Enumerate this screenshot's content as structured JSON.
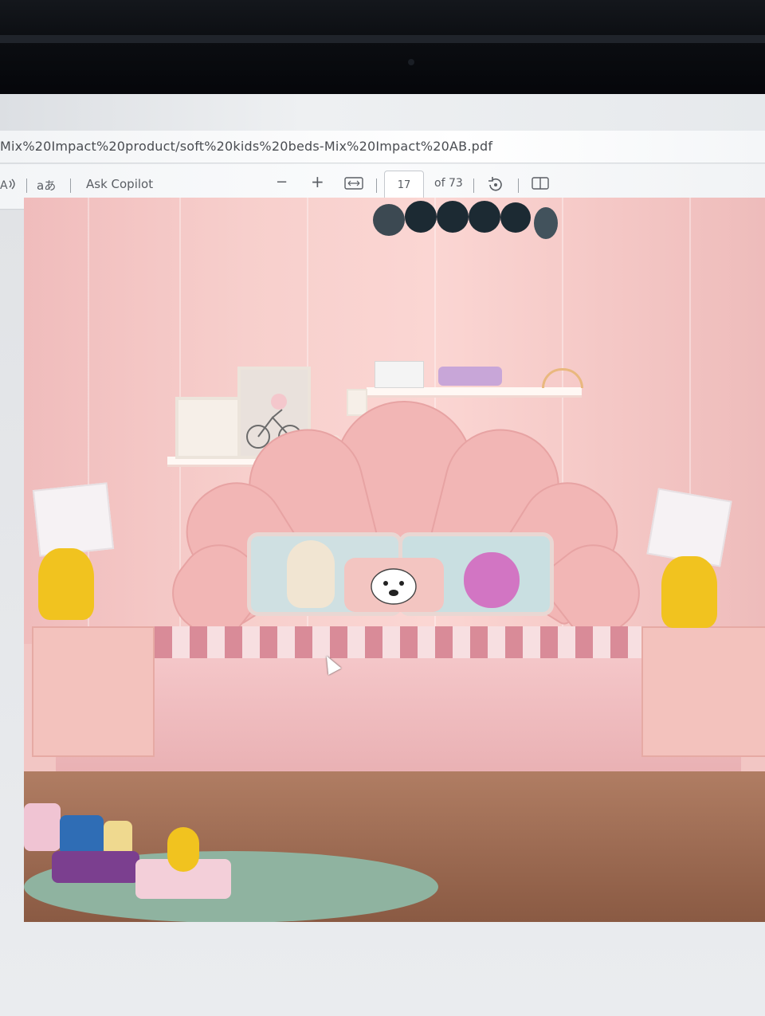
{
  "browser": {
    "url_text": "Mix%20Impact%20product/soft%20kids%20beds-Mix%20Impact%20AB.pdf"
  },
  "pdf_toolbar": {
    "read_aloud_icon": "read-aloud-icon",
    "translate_label": "aあ",
    "ask_copilot_label": "Ask Copilot",
    "zoom_out_label": "−",
    "zoom_in_label": "+",
    "fit_icon": "fit-page-icon",
    "page_number": "17",
    "page_total": "of 73",
    "rotate_icon": "rotate-icon",
    "two_page_icon": "two-page-view-icon"
  },
  "document": {
    "image_alt": "",
    "colors": {
      "wall": "#f7cfcc",
      "bed": "#efb9b2",
      "lamp_base": "#f1c31f"
    }
  }
}
